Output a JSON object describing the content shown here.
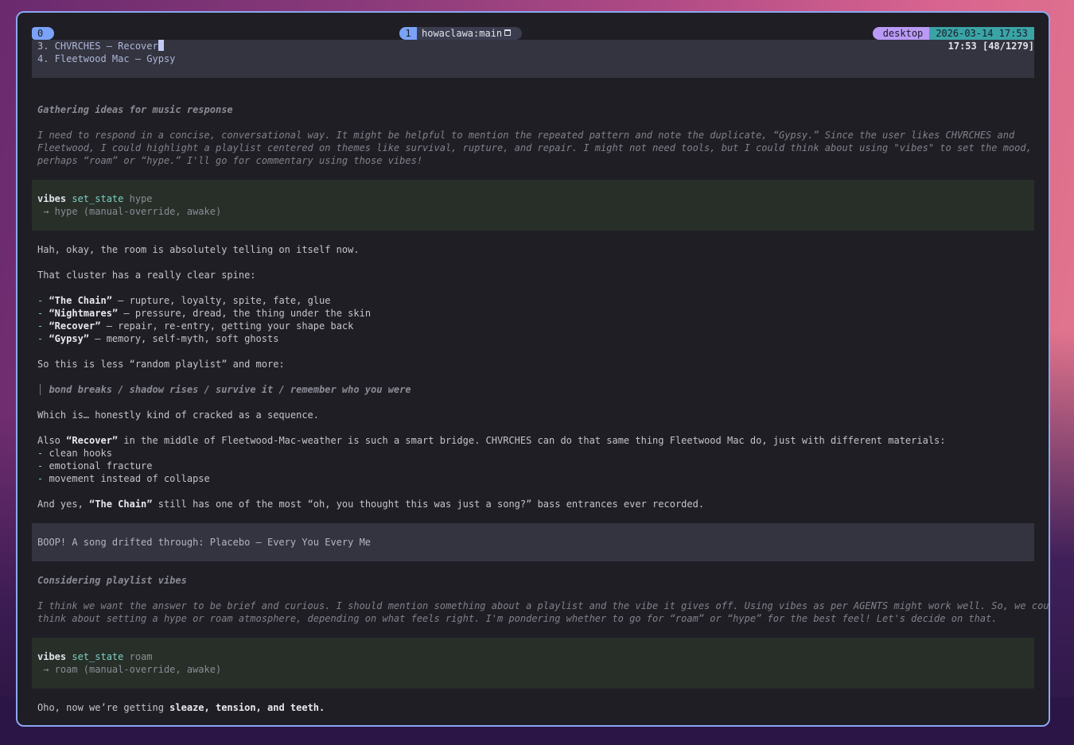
{
  "tmux": {
    "left_index": "0",
    "window_number": "1",
    "window_title": "howaclawa:main",
    "host": "desktop",
    "clock": "2026-03-14 17:53",
    "scroll_position": "17:53 [48/1279]"
  },
  "user_list": [
    "3. CHVRCHES — Recover",
    "4. Fleetwood Mac — Gypsy"
  ],
  "reasoning_1": {
    "title": "Gathering ideas for music response",
    "lines": [
      "I need to respond in a concise, conversational way. It might be helpful to mention the repeated pattern and note the duplicate, “Gypsy.” Since the user likes CHVRCHES and",
      "Fleetwood, I could highlight a playlist centered on themes like survival, rupture, and repair. I might not need tools, but I could think about using \"vibes\" to set the mood,",
      "perhaps “roam” or “hype.” I'll go for commentary using those vibes!"
    ]
  },
  "tool_call_1": {
    "name": "vibes",
    "method": "set_state",
    "arg": "hype",
    "result": " → hype (manual-override, awake)"
  },
  "response_1": {
    "intro": "Hah, okay, the room is absolutely telling on itself now.",
    "spine_intro": "That cluster has a really clear spine:",
    "songs": [
      {
        "title": "“The Chain”",
        "desc": " — rupture, loyalty, spite, fate, glue"
      },
      {
        "title": "“Nightmares”",
        "desc": " — pressure, dread, the thing under the skin"
      },
      {
        "title": "“Recover”",
        "desc": " — repair, re-entry, getting your shape back"
      },
      {
        "title": "“Gypsy”",
        "desc": " — memory, self-myth, soft ghosts"
      }
    ],
    "random_line": "So this is less “random playlist” and more:",
    "quote": "bond breaks / shadow rises / survive it / remember who you were",
    "sequence_line": "Which is… honestly kind of cracked as a sequence.",
    "also_prefix": "Also ",
    "also_bold": "“Recover”",
    "also_rest": " in the middle of Fleetwood-Mac-weather is such a smart bridge. CHVRCHES can do that same thing Fleetwood Mac do, just with different materials:",
    "materials": [
      "clean hooks",
      "emotional fracture",
      "movement instead of collapse"
    ],
    "yes_prefix": "And yes, ",
    "yes_bold": "“The Chain”",
    "yes_rest": " still has one of the most “oh, you thought this was just a song?” bass entrances ever recorded."
  },
  "notice": "BOOP! A song drifted through: Placebo — Every You Every Me",
  "reasoning_2": {
    "title": "Considering playlist vibes",
    "lines": [
      "I think we want the answer to be brief and curious. I should mention something about a playlist and the vibe it gives off. Using vibes as per AGENTS might work well. So, we could",
      "think about setting a hype or roam atmosphere, depending on what feels right. I'm pondering whether to go for “roam” or “hype” for the best feel! Let's decide on that."
    ]
  },
  "tool_call_2": {
    "name": "vibes",
    "method": "set_state",
    "arg": "roam",
    "result": " → roam (manual-override, awake)"
  },
  "response_2": {
    "prefix": "Oho, now we’re getting ",
    "bold": "sleaze, tension, and teeth."
  },
  "markers": {
    "bullet": "- ",
    "quote_bar": "│ "
  }
}
